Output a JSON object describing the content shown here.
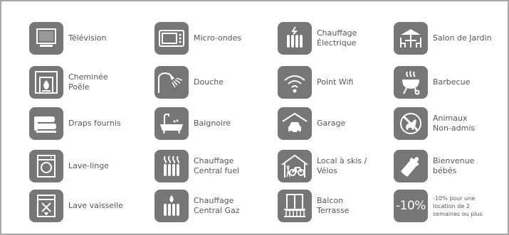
{
  "colors": {
    "icon_bg": "#777676",
    "text": "#575757",
    "frame": "#a7a7a7"
  },
  "items": [
    {
      "icon": "tv-icon",
      "lines": [
        "Télévision"
      ]
    },
    {
      "icon": "microwave-icon",
      "lines": [
        "Micro-ondes"
      ]
    },
    {
      "icon": "electric-heater-icon",
      "lines": [
        "Chauffage",
        "Électrique"
      ]
    },
    {
      "icon": "garden-furniture-icon",
      "lines": [
        "Salon de Jardin"
      ]
    },
    {
      "icon": "fireplace-icon",
      "lines": [
        "Cheminée",
        "Poêle"
      ]
    },
    {
      "icon": "shower-icon",
      "lines": [
        "Douche"
      ]
    },
    {
      "icon": "wifi-icon",
      "lines": [
        "Point Wifi"
      ]
    },
    {
      "icon": "barbecue-icon",
      "lines": [
        "Barbecue"
      ]
    },
    {
      "icon": "towels-icon",
      "lines": [
        "Draps fournis"
      ]
    },
    {
      "icon": "bathtub-icon",
      "lines": [
        "Baignoire"
      ]
    },
    {
      "icon": "garage-icon",
      "lines": [
        "Garage"
      ]
    },
    {
      "icon": "no-pets-icon",
      "lines": [
        "Animaux",
        "Non-admis"
      ]
    },
    {
      "icon": "washing-machine-icon",
      "lines": [
        "Lave-linge"
      ]
    },
    {
      "icon": "fuel-heating-icon",
      "lines": [
        "Chauffage",
        "Central fuel"
      ]
    },
    {
      "icon": "ski-bike-storage-icon",
      "lines": [
        "Local à skis /",
        "Vélos"
      ]
    },
    {
      "icon": "baby-bottle-icon",
      "lines": [
        "Bienvenue",
        "bébés"
      ]
    },
    {
      "icon": "dishwasher-icon",
      "lines": [
        "Lave vaisselle"
      ]
    },
    {
      "icon": "gas-heating-icon",
      "lines": [
        "Chauffage",
        "Central Gaz"
      ]
    },
    {
      "icon": "balcony-icon",
      "lines": [
        "Balcon",
        "Terrasse"
      ]
    },
    {
      "icon": "discount-icon",
      "badge": "-10%",
      "small": true,
      "lines": [
        "-10% pour une",
        "location de 2",
        "semaines ou plus"
      ]
    }
  ]
}
